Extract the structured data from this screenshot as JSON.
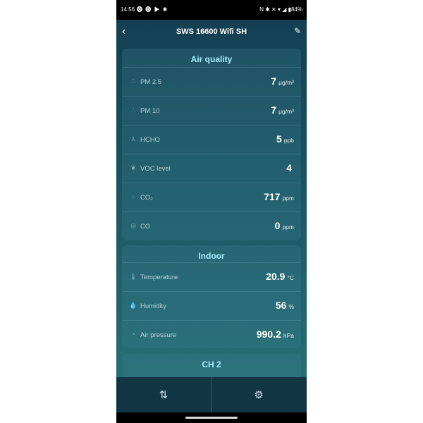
{
  "status_bar": {
    "time": "14:56",
    "left_icons": "⓿ ⓿ ▶ ✱",
    "right_text": "N ✱ ✕ ▾ ◢ ▮84%"
  },
  "header": {
    "back_icon": "‹",
    "title": "SWS 16600 Wifi SH",
    "edit_icon": "✎"
  },
  "air_quality": {
    "title": "Air quality",
    "rows": [
      {
        "icon": "∴",
        "label": "PM 2.5",
        "value": "7",
        "unit": "μg/m³"
      },
      {
        "icon": "∴",
        "label": "PM 10",
        "value": "7",
        "unit": "μg/m³"
      },
      {
        "icon": "⅄",
        "label": "HCHO",
        "value": "5",
        "unit": "ppb"
      },
      {
        "icon": "❦",
        "label": "VOC level",
        "value": "4",
        "unit": ""
      },
      {
        "icon": "◌",
        "label": "CO₂",
        "value": "717",
        "unit": "ppm"
      },
      {
        "icon": "◎",
        "label": "CO",
        "value": "0",
        "unit": "ppm"
      }
    ]
  },
  "indoor": {
    "title": "Indoor",
    "rows": [
      {
        "icon": "🌡",
        "label": "Temperature",
        "value": "20.9",
        "unit": "°C"
      },
      {
        "icon": "💧",
        "label": "Humidity",
        "value": "56",
        "unit": "%"
      },
      {
        "icon": "◔",
        "label": "Air pressure",
        "value": "990.2",
        "unit": "hPa"
      }
    ]
  },
  "ch2": {
    "title": "CH 2"
  },
  "bottom_nav": {
    "sort_icon": "⇅",
    "settings_icon": "⚙"
  }
}
